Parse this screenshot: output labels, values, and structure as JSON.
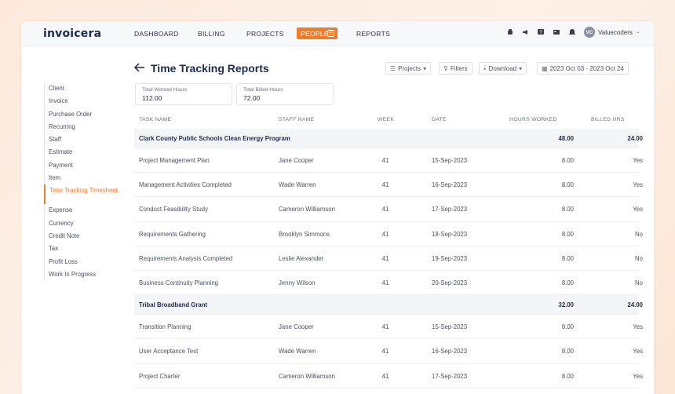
{
  "brand": "invoicera",
  "nav": {
    "items": [
      "DASHBOARD",
      "BILLING",
      "PROJECTS",
      "PEOPLE",
      "REPORTS"
    ],
    "active": "PEOPLE",
    "user": "Valuecoders",
    "avatar_initials": "VC"
  },
  "icons": [
    "android-icon",
    "megaphone-icon",
    "help-icon",
    "card-icon",
    "bell-icon"
  ],
  "sidebar": {
    "items": [
      "Client",
      "Invoice",
      "Purchase Order",
      "Recurring",
      "Staff",
      "Estimate",
      "Payment",
      "Item",
      "Time Tracking Timesheet",
      "Expense",
      "Currency",
      "Credit Note",
      "Tax",
      "Profit Loss",
      "Work In Progress"
    ],
    "active_index": 8
  },
  "header": {
    "title": "Time Tracking Reports",
    "projects_label": "Projects",
    "filters_label": "Filters",
    "download_label": "Download",
    "date_range": "2023 Oct 03 - 2023 Oct 24"
  },
  "summary": {
    "worked_label": "Total Worked Hours",
    "worked_value": "112.00",
    "billed_label": "Total Billed Hours",
    "billed_value": "72.00"
  },
  "table": {
    "headers": [
      "TASK NAME",
      "STAFF NAME",
      "WEEK",
      "DATE",
      "HOURS WORKED",
      "BILLED HRS"
    ],
    "groups": [
      {
        "name": "Clark County Public Schools Clean Energy Program",
        "hours": "48.00",
        "billed": "24.00",
        "rows": [
          {
            "task": "Project Management Plan",
            "staff": "Jane Cooper",
            "week": "41",
            "date": "15-Sep-2023",
            "hours": "8.00",
            "billed": "Yes"
          },
          {
            "task": "Management Activities Completed",
            "staff": "Wade Warren",
            "week": "41",
            "date": "16-Sep-2023",
            "hours": "8.00",
            "billed": "Yes"
          },
          {
            "task": "Conduct Feasibility Study",
            "staff": "Cameron Williamson",
            "week": "41",
            "date": "17-Sep-2023",
            "hours": "8.00",
            "billed": "Yes"
          },
          {
            "task": "Requirements Gathering",
            "staff": "Brooklyn Simmons",
            "week": "41",
            "date": "18-Sep-2023",
            "hours": "8.00",
            "billed": "No"
          },
          {
            "task": "Requirements Analysis Completed",
            "staff": "Leslie Alexander",
            "week": "41",
            "date": "19-Sep-2023",
            "hours": "8.00",
            "billed": "No"
          },
          {
            "task": "Business Continuity Planning",
            "staff": "Jenny Wilson",
            "week": "41",
            "date": "20-Sep-2023",
            "hours": "8.00",
            "billed": "No"
          }
        ]
      },
      {
        "name": "Tribal Broadband Grant",
        "hours": "32.00",
        "billed": "24.00",
        "rows": [
          {
            "task": "Transition Planning",
            "staff": "Jane Cooper",
            "week": "41",
            "date": "15-Sep-2023",
            "hours": "8.00",
            "billed": "Yes"
          },
          {
            "task": "User Acceptance Test",
            "staff": "Wade Warren",
            "week": "41",
            "date": "16-Sep-2023",
            "hours": "8.00",
            "billed": "Yes"
          },
          {
            "task": "Project Charter",
            "staff": "Cameron Williamson",
            "week": "41",
            "date": "17-Sep-2023",
            "hours": "8.00",
            "billed": "Yes"
          }
        ]
      }
    ]
  },
  "colors": {
    "accent": "#f07b2b",
    "title": "#1d2b4f",
    "group_bg": "#f4f5f7"
  }
}
